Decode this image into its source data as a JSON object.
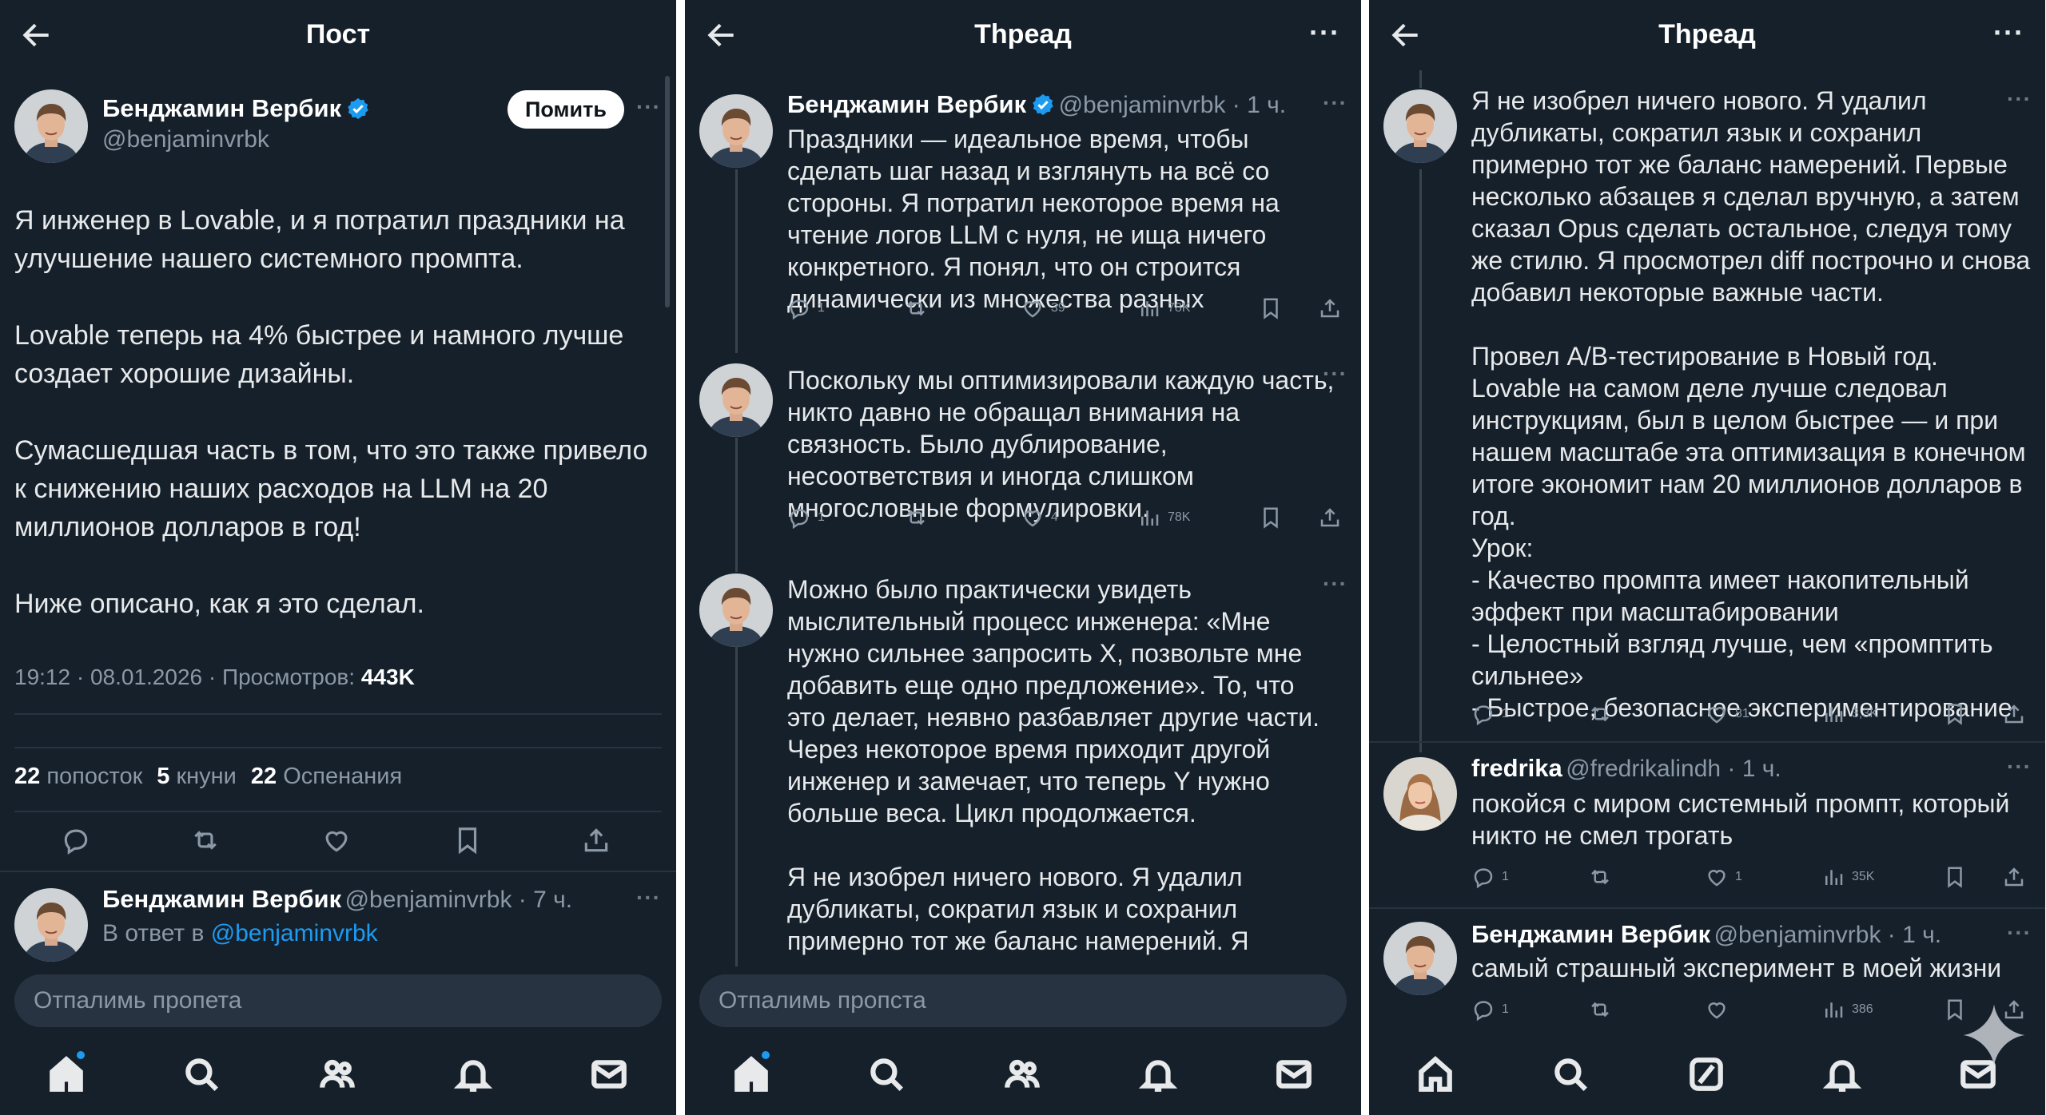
{
  "colors": {
    "bg": "#15202b",
    "accent": "#1d9bf0",
    "text": "#e7e9ea",
    "muted": "#8b98a5"
  },
  "panel1": {
    "header_title": "Пост",
    "author": {
      "name": "Бенджамин Вербик",
      "handle": "@benjaminvrbk",
      "verified": true
    },
    "follow_label": "Помить",
    "more": "···",
    "body": "Я инженер в Lovable, и я потратил праздники на улучшение нашего системного промпта.\n\nLovable теперь на 4% быстрее и намного лучше создает хорошие дизайны.\n\nСумасшедшая часть в том, что это также привело к снижению наших расходов на LLM на 20 миллионов долларов в год!\n\nНиже описано, как я это сделал.",
    "meta_time": "19:12 · 08.01.2026 · Просмотров: ",
    "meta_views": "443K",
    "stats": [
      {
        "count": "22",
        "label": "попосток"
      },
      {
        "count": "5",
        "label": "кнуни"
      },
      {
        "count": "22",
        "label": "Оспенания"
      }
    ],
    "reply": {
      "name": "Бенджамин Вербик",
      "handle": "@benjaminvrbk · 7 ч.",
      "prefix": "В ответ в ",
      "mention": "@benjaminvrbk"
    },
    "reply_placeholder": "Отпалимь пропета"
  },
  "panel2": {
    "header_title": "Thpeaд",
    "more": "···",
    "tweets": [
      {
        "name": "Бенджамин Вербик",
        "handle": "@benjaminvrbk · 1 ч.",
        "body": "Праздники — идеальное время, чтобы сделать шаг назад и взглянуть на всё со стороны. Я потратил некоторое время на чтение логов LLM с нуля, не ища ничего конкретного. Я понял, что он строится динамически из множества разных",
        "replies": "1",
        "likes": "39",
        "views": "78K"
      },
      {
        "body": "Поскольку мы оптимизировали каждую часть, никто давно не обращал внимания на связность. Было дублирование, несоответствия и иногда слишком многословные формулировки.",
        "replies": "1",
        "likes": "4",
        "views": "78K"
      },
      {
        "body": "Можно было практически увидеть мыслительный процесс инженера: «Мне нужно сильнее запросить X, позвольте мне добавить еще одно предложение». То, что это делает, неявно разбавляет другие части. Через некоторое время приходит другой инженер и замечает, что теперь Y нужно больше веса. Цикл продолжается.\n\nЯ не изобрел ничего нового. Я удалил дубликаты, сократил язык и сохранил примерно тот же баланс намерений. Я"
      }
    ],
    "reply_placeholder": "Отпалимь пропста"
  },
  "panel3": {
    "header_title": "Thpeaд",
    "more": "···",
    "tweets": [
      {
        "body": "Я не изобрел ничего нового. Я удалил дубликаты, сократил язык и сохранил примерно тот же баланс намерений. Первые несколько абзацев я сделал вручную, а затем сказал Opus сделать остальное, следуя тому же стилю. Я просмотрел diff построчно и снова добавил некоторые важные части.\n\nПровел A/B-тестирование в Новый год. Lovable на самом деле лучше следовал инструкциям, был в целом быстрее — и при нашем масштабе эта оптимизация в конечном итоге экономит нам 20 миллионов долларов в год.\nУрок:\n- Качество промпта имеет накопительный эффект при масштабировании\n- Целостный взгляд лучше, чем «промптить сильнее»\n- Быстрое, безопасное экспериментирование",
        "replies": "1",
        "likes": "81",
        "views": "3,3K"
      },
      {
        "name": "fredrika",
        "handle": "@fredrikalindh · 1 ч.",
        "body": "покойся с миром системный промпт, который никто не смел трогать",
        "replies": "1",
        "likes": "1",
        "views": "35K"
      },
      {
        "name": "Бенджамин Вербик",
        "handle": "@benjaminvrbk · 1 ч.",
        "body": "самый страшный эксперимент в моей жизни",
        "replies": "1",
        "likes": "",
        "views": "386"
      }
    ]
  }
}
